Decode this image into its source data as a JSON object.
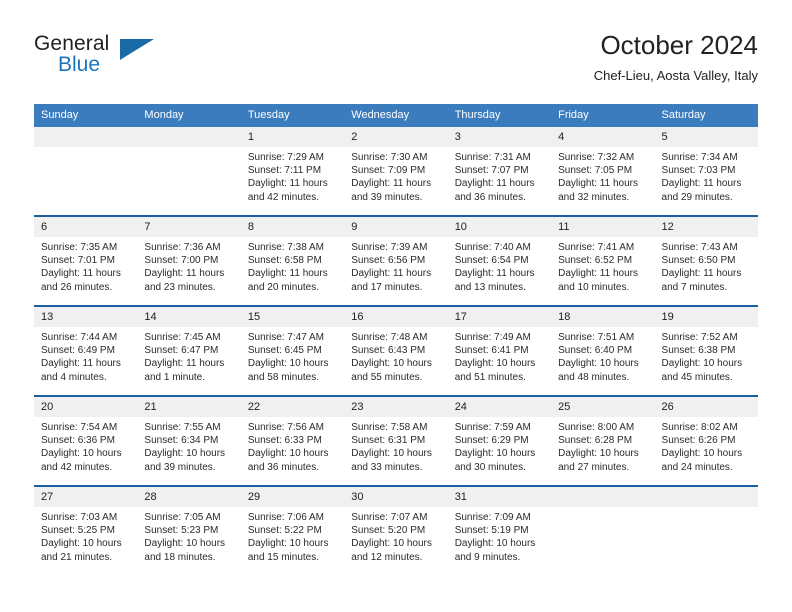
{
  "brand": {
    "name_top": "General",
    "name_bottom": "Blue",
    "accent_color": "#1c75bc",
    "triangle_color": "#1a6aa8"
  },
  "header": {
    "month_title": "October 2024",
    "location": "Chef-Lieu, Aosta Valley, Italy"
  },
  "theme": {
    "header_row_bg": "#3a7cbe",
    "row_divider": "#1a5fa0",
    "daynum_bg": "#f0f0f0",
    "text": "#222222"
  },
  "weekday_headers": [
    "Sunday",
    "Monday",
    "Tuesday",
    "Wednesday",
    "Thursday",
    "Friday",
    "Saturday"
  ],
  "labels": {
    "sunrise_prefix": "Sunrise:",
    "sunset_prefix": "Sunset:",
    "daylight_prefix": "Daylight:"
  },
  "weeks": [
    [
      {
        "day": "",
        "sunrise": "",
        "sunset": "",
        "daylight_a": "",
        "daylight_b": ""
      },
      {
        "day": "",
        "sunrise": "",
        "sunset": "",
        "daylight_a": "",
        "daylight_b": ""
      },
      {
        "day": "1",
        "sunrise": "Sunrise: 7:29 AM",
        "sunset": "Sunset: 7:11 PM",
        "daylight_a": "Daylight: 11 hours",
        "daylight_b": "and 42 minutes."
      },
      {
        "day": "2",
        "sunrise": "Sunrise: 7:30 AM",
        "sunset": "Sunset: 7:09 PM",
        "daylight_a": "Daylight: 11 hours",
        "daylight_b": "and 39 minutes."
      },
      {
        "day": "3",
        "sunrise": "Sunrise: 7:31 AM",
        "sunset": "Sunset: 7:07 PM",
        "daylight_a": "Daylight: 11 hours",
        "daylight_b": "and 36 minutes."
      },
      {
        "day": "4",
        "sunrise": "Sunrise: 7:32 AM",
        "sunset": "Sunset: 7:05 PM",
        "daylight_a": "Daylight: 11 hours",
        "daylight_b": "and 32 minutes."
      },
      {
        "day": "5",
        "sunrise": "Sunrise: 7:34 AM",
        "sunset": "Sunset: 7:03 PM",
        "daylight_a": "Daylight: 11 hours",
        "daylight_b": "and 29 minutes."
      }
    ],
    [
      {
        "day": "6",
        "sunrise": "Sunrise: 7:35 AM",
        "sunset": "Sunset: 7:01 PM",
        "daylight_a": "Daylight: 11 hours",
        "daylight_b": "and 26 minutes."
      },
      {
        "day": "7",
        "sunrise": "Sunrise: 7:36 AM",
        "sunset": "Sunset: 7:00 PM",
        "daylight_a": "Daylight: 11 hours",
        "daylight_b": "and 23 minutes."
      },
      {
        "day": "8",
        "sunrise": "Sunrise: 7:38 AM",
        "sunset": "Sunset: 6:58 PM",
        "daylight_a": "Daylight: 11 hours",
        "daylight_b": "and 20 minutes."
      },
      {
        "day": "9",
        "sunrise": "Sunrise: 7:39 AM",
        "sunset": "Sunset: 6:56 PM",
        "daylight_a": "Daylight: 11 hours",
        "daylight_b": "and 17 minutes."
      },
      {
        "day": "10",
        "sunrise": "Sunrise: 7:40 AM",
        "sunset": "Sunset: 6:54 PM",
        "daylight_a": "Daylight: 11 hours",
        "daylight_b": "and 13 minutes."
      },
      {
        "day": "11",
        "sunrise": "Sunrise: 7:41 AM",
        "sunset": "Sunset: 6:52 PM",
        "daylight_a": "Daylight: 11 hours",
        "daylight_b": "and 10 minutes."
      },
      {
        "day": "12",
        "sunrise": "Sunrise: 7:43 AM",
        "sunset": "Sunset: 6:50 PM",
        "daylight_a": "Daylight: 11 hours",
        "daylight_b": "and 7 minutes."
      }
    ],
    [
      {
        "day": "13",
        "sunrise": "Sunrise: 7:44 AM",
        "sunset": "Sunset: 6:49 PM",
        "daylight_a": "Daylight: 11 hours",
        "daylight_b": "and 4 minutes."
      },
      {
        "day": "14",
        "sunrise": "Sunrise: 7:45 AM",
        "sunset": "Sunset: 6:47 PM",
        "daylight_a": "Daylight: 11 hours",
        "daylight_b": "and 1 minute."
      },
      {
        "day": "15",
        "sunrise": "Sunrise: 7:47 AM",
        "sunset": "Sunset: 6:45 PM",
        "daylight_a": "Daylight: 10 hours",
        "daylight_b": "and 58 minutes."
      },
      {
        "day": "16",
        "sunrise": "Sunrise: 7:48 AM",
        "sunset": "Sunset: 6:43 PM",
        "daylight_a": "Daylight: 10 hours",
        "daylight_b": "and 55 minutes."
      },
      {
        "day": "17",
        "sunrise": "Sunrise: 7:49 AM",
        "sunset": "Sunset: 6:41 PM",
        "daylight_a": "Daylight: 10 hours",
        "daylight_b": "and 51 minutes."
      },
      {
        "day": "18",
        "sunrise": "Sunrise: 7:51 AM",
        "sunset": "Sunset: 6:40 PM",
        "daylight_a": "Daylight: 10 hours",
        "daylight_b": "and 48 minutes."
      },
      {
        "day": "19",
        "sunrise": "Sunrise: 7:52 AM",
        "sunset": "Sunset: 6:38 PM",
        "daylight_a": "Daylight: 10 hours",
        "daylight_b": "and 45 minutes."
      }
    ],
    [
      {
        "day": "20",
        "sunrise": "Sunrise: 7:54 AM",
        "sunset": "Sunset: 6:36 PM",
        "daylight_a": "Daylight: 10 hours",
        "daylight_b": "and 42 minutes."
      },
      {
        "day": "21",
        "sunrise": "Sunrise: 7:55 AM",
        "sunset": "Sunset: 6:34 PM",
        "daylight_a": "Daylight: 10 hours",
        "daylight_b": "and 39 minutes."
      },
      {
        "day": "22",
        "sunrise": "Sunrise: 7:56 AM",
        "sunset": "Sunset: 6:33 PM",
        "daylight_a": "Daylight: 10 hours",
        "daylight_b": "and 36 minutes."
      },
      {
        "day": "23",
        "sunrise": "Sunrise: 7:58 AM",
        "sunset": "Sunset: 6:31 PM",
        "daylight_a": "Daylight: 10 hours",
        "daylight_b": "and 33 minutes."
      },
      {
        "day": "24",
        "sunrise": "Sunrise: 7:59 AM",
        "sunset": "Sunset: 6:29 PM",
        "daylight_a": "Daylight: 10 hours",
        "daylight_b": "and 30 minutes."
      },
      {
        "day": "25",
        "sunrise": "Sunrise: 8:00 AM",
        "sunset": "Sunset: 6:28 PM",
        "daylight_a": "Daylight: 10 hours",
        "daylight_b": "and 27 minutes."
      },
      {
        "day": "26",
        "sunrise": "Sunrise: 8:02 AM",
        "sunset": "Sunset: 6:26 PM",
        "daylight_a": "Daylight: 10 hours",
        "daylight_b": "and 24 minutes."
      }
    ],
    [
      {
        "day": "27",
        "sunrise": "Sunrise: 7:03 AM",
        "sunset": "Sunset: 5:25 PM",
        "daylight_a": "Daylight: 10 hours",
        "daylight_b": "and 21 minutes."
      },
      {
        "day": "28",
        "sunrise": "Sunrise: 7:05 AM",
        "sunset": "Sunset: 5:23 PM",
        "daylight_a": "Daylight: 10 hours",
        "daylight_b": "and 18 minutes."
      },
      {
        "day": "29",
        "sunrise": "Sunrise: 7:06 AM",
        "sunset": "Sunset: 5:22 PM",
        "daylight_a": "Daylight: 10 hours",
        "daylight_b": "and 15 minutes."
      },
      {
        "day": "30",
        "sunrise": "Sunrise: 7:07 AM",
        "sunset": "Sunset: 5:20 PM",
        "daylight_a": "Daylight: 10 hours",
        "daylight_b": "and 12 minutes."
      },
      {
        "day": "31",
        "sunrise": "Sunrise: 7:09 AM",
        "sunset": "Sunset: 5:19 PM",
        "daylight_a": "Daylight: 10 hours",
        "daylight_b": "and 9 minutes."
      },
      {
        "day": "",
        "sunrise": "",
        "sunset": "",
        "daylight_a": "",
        "daylight_b": ""
      },
      {
        "day": "",
        "sunrise": "",
        "sunset": "",
        "daylight_a": "",
        "daylight_b": ""
      }
    ]
  ]
}
